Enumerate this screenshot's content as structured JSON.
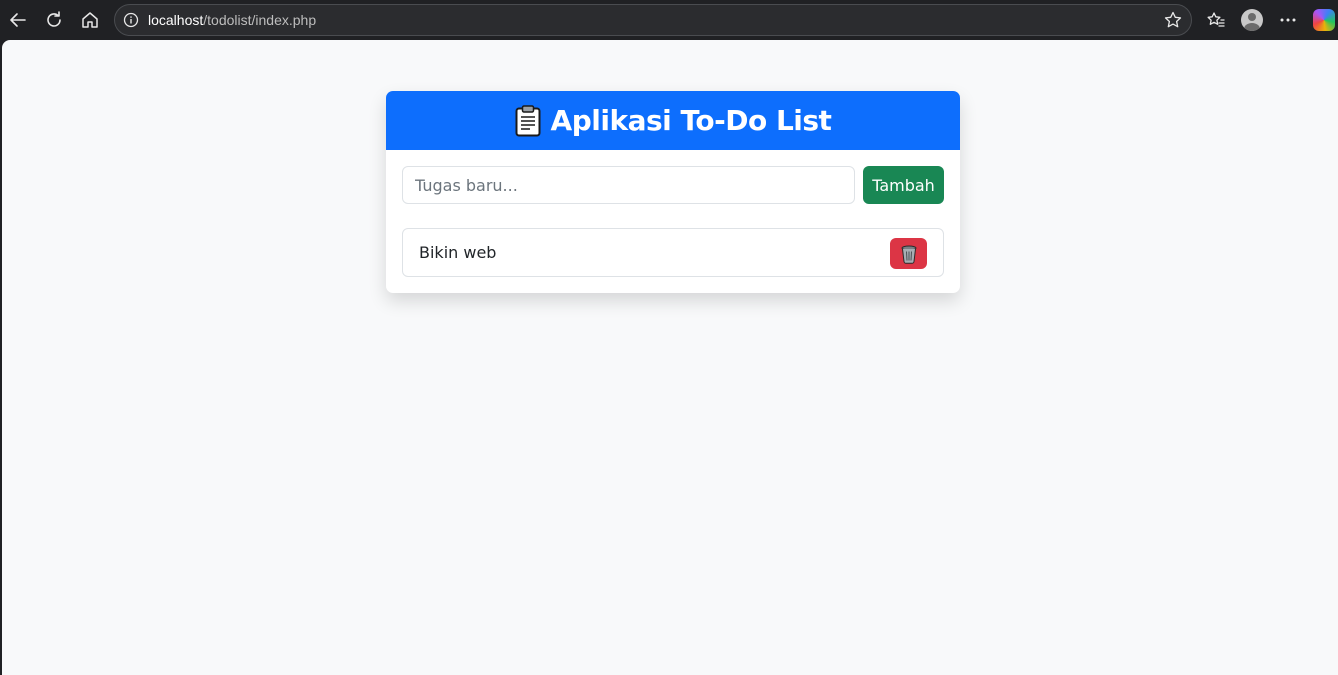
{
  "browser": {
    "url_host": "localhost",
    "url_path": "/todolist/index.php"
  },
  "app": {
    "title": "Aplikasi To-Do List",
    "header_icon": "clipboard-icon",
    "accent_color": "#0d6efd"
  },
  "form": {
    "input_value": "",
    "input_placeholder": "Tugas baru...",
    "add_label": "Tambah"
  },
  "tasks": [
    {
      "text": "Bikin web",
      "delete_icon": "trash-icon"
    }
  ]
}
